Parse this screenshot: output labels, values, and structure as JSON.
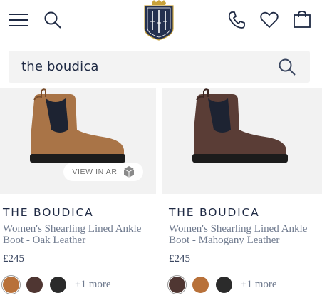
{
  "search": {
    "value": "the boudica",
    "placeholder": "Search"
  },
  "header": {
    "icons": [
      "menu-icon",
      "search-icon",
      "brand-logo",
      "phone-icon",
      "heart-icon",
      "bag-icon"
    ]
  },
  "products": [
    {
      "brand": "THE BOUDICA",
      "name": "Women's Shearling Lined Ankle Boot - Oak Leather",
      "price": "£245",
      "ar_label": "VIEW IN AR",
      "swatches": [
        "#b8713a",
        "#4f3632",
        "#2b2b2b"
      ],
      "selected_swatch": 0,
      "more_label": "+1 more",
      "boot_color": "#a97447"
    },
    {
      "brand": "THE BOUDICA",
      "name": "Women's Shearling Lined Ankle Boot - Mahogany Leather",
      "price": "£245",
      "swatches": [
        "#4f3632",
        "#b8713a",
        "#2b2b2b"
      ],
      "selected_swatch": 0,
      "more_label": "+1 more",
      "boot_color": "#5a3d36"
    }
  ],
  "colors": {
    "navy": "#1f2a44",
    "text_muted": "#6f7a8e",
    "image_bg": "#f2f2f2"
  }
}
